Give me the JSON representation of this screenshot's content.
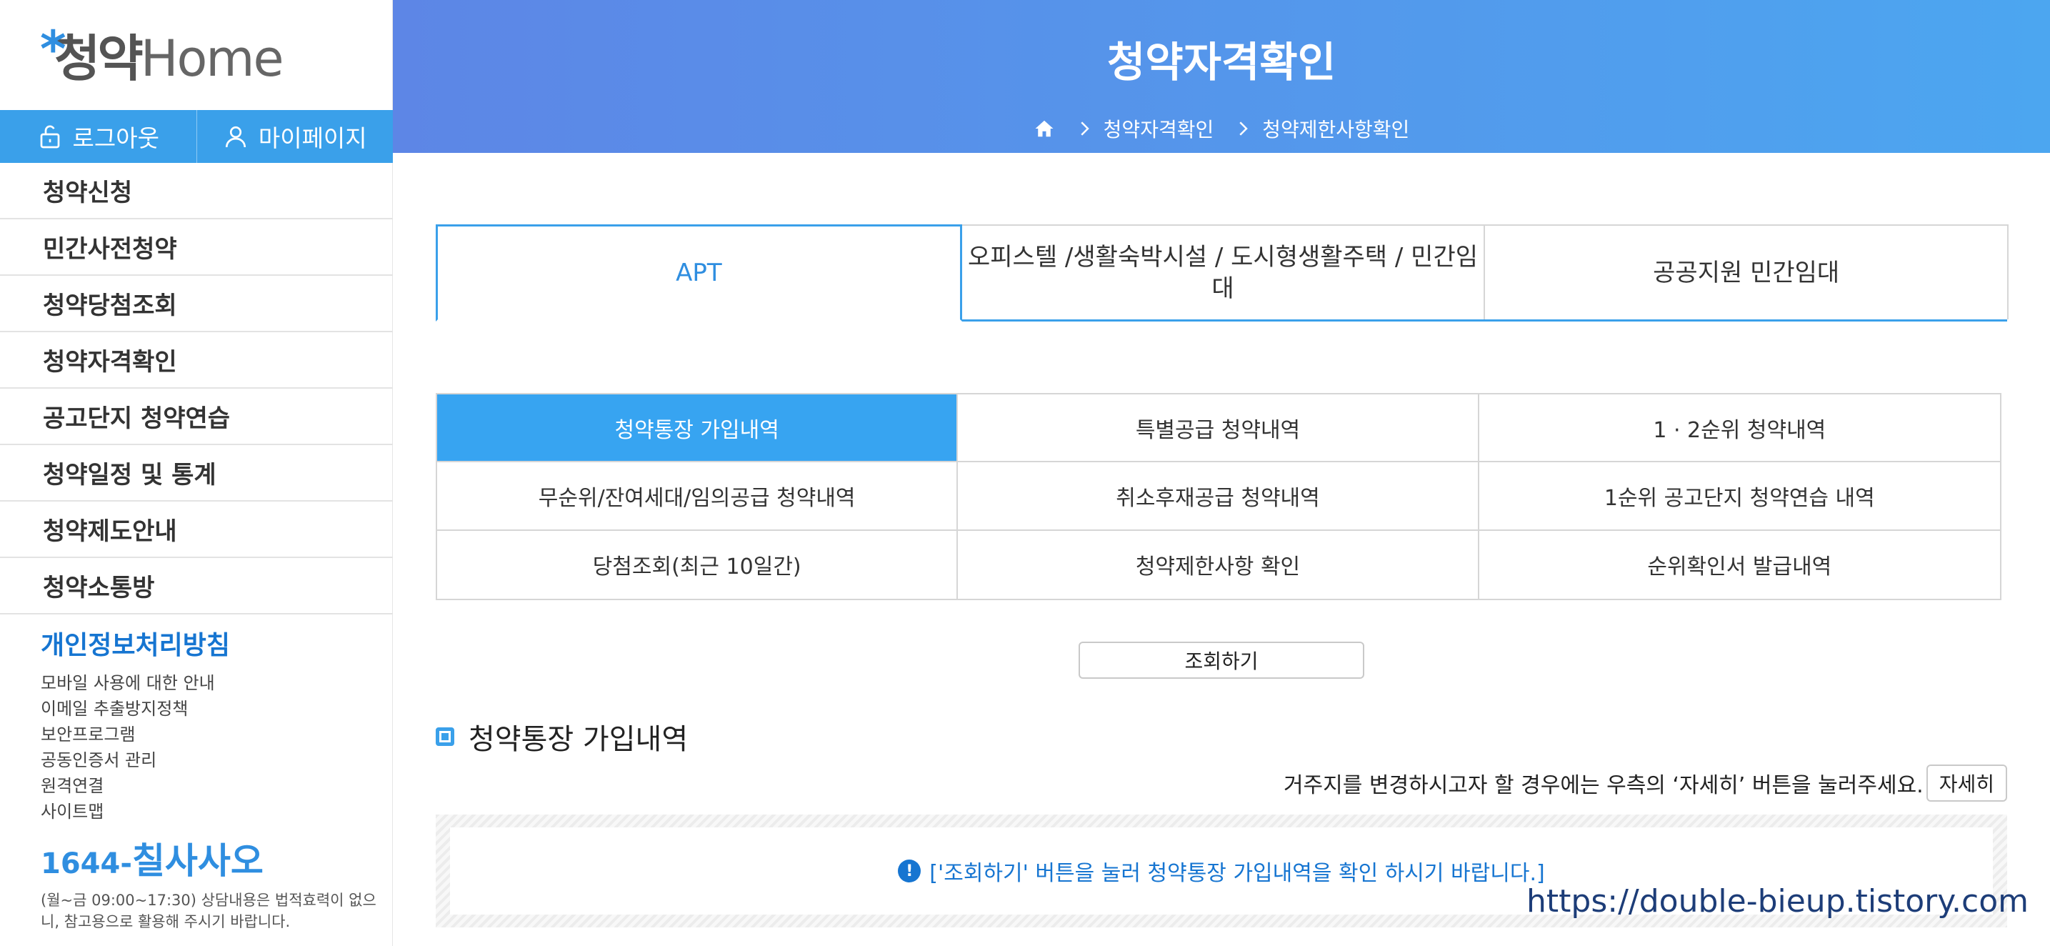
{
  "logo": {
    "mark": "청약",
    "home": "Home"
  },
  "auth": {
    "logout_label": "로그아웃",
    "mypage_label": "마이페이지"
  },
  "menu": {
    "items": [
      "청약신청",
      "민간사전청약",
      "청약당첨조회",
      "청약자격확인",
      "공고단지 청약연습",
      "청약일정 및 통계",
      "청약제도안내",
      "청약소통방"
    ]
  },
  "policy": {
    "title": "개인정보처리방침",
    "links": [
      "모바일 사용에 대한 안내",
      "이메일 추출방지정책",
      "보안프로그램",
      "공동인증서 관리",
      "원격연결",
      "사이트맵"
    ]
  },
  "contact": {
    "number_prefix": "1644-",
    "number_main": "칠사사오",
    "desc": "(월~금 09:00~17:30) 상담내용은 법적효력이 없으니, 참고용으로 활용해 주시기 바랍니다."
  },
  "header": {
    "title": "청약자격확인",
    "breadcrumb": [
      "청약자격확인",
      "청약제한사항확인"
    ]
  },
  "type_tabs": [
    "APT",
    "오피스텔 /생활숙박시설 / 도시형생활주택 / 민간임대",
    "공공지원 민간임대"
  ],
  "sub_tabs": [
    "청약통장 가입내역",
    "특별공급 청약내역",
    "1 · 2순위 청약내역",
    "무순위/잔여세대/임의공급 청약내역",
    "취소후재공급 청약내역",
    "1순위 공고단지 청약연습 내역",
    "당첨조회(최근 10일간)",
    "청약제한사항 확인",
    "순위확인서 발급내역"
  ],
  "query_button": "조회하기",
  "section": {
    "title": "청약통장 가입내역",
    "notice": "거주지를 변경하시고자 할 경우에는 우측의 ‘자세히’ 버튼을 눌러주세요.",
    "detail_button": "자세히",
    "result_message": "['조회하기' 버튼을 눌러 청약통장 가입내역을 확인 하시기 바랍니다.]"
  },
  "watermark": "https://double-bieup.tistory.com",
  "colors": {
    "accent": "#3aa0ea",
    "link_blue": "#1675d1",
    "header_start": "#5d86e6",
    "header_end": "#4ca6f0"
  }
}
